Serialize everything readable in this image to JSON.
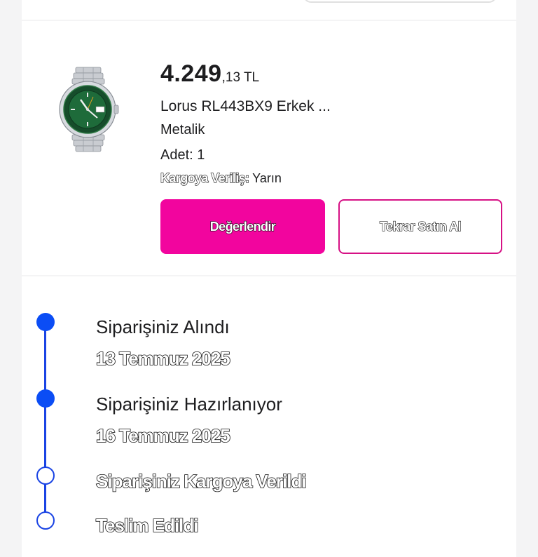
{
  "product": {
    "price_main": "4.249",
    "price_decimal": ",13 TL",
    "name": "Lorus RL443BX9 Erkek ...",
    "color": "Metalik",
    "quantity": "Adet: 1",
    "shipping_label": "Kargoya Veriliş:",
    "shipping_value": " Yarın",
    "watch_brand": "LORUS",
    "rate_button": "Değerlendir",
    "rebuy_button": "Tekrar Satın Al"
  },
  "timeline": [
    {
      "title": "Siparişiniz Alındı",
      "date": "13 Temmuz 2025",
      "done": true
    },
    {
      "title": "Siparişiniz Hazırlanıyor",
      "date": "16 Temmuz 2025",
      "done": true
    },
    {
      "title": "Siparişiniz Kargoya Verildi",
      "done": false
    },
    {
      "title": "Teslim Edildi",
      "done": false
    }
  ],
  "colors": {
    "accent_pink": "#f2059e",
    "timeline_blue": "#0b4df5",
    "watch_dial_green": "#1e6b3a"
  },
  "icons": {
    "product_image": "watch-icon"
  }
}
